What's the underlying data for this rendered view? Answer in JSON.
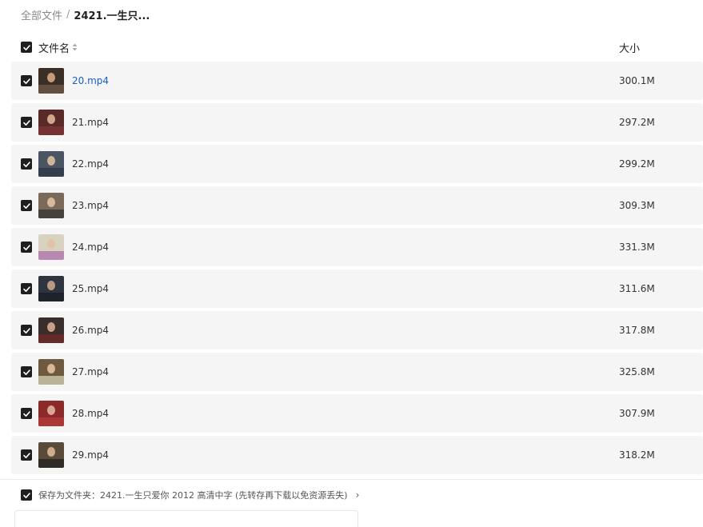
{
  "breadcrumb": {
    "root": "全部文件",
    "separator": "/",
    "current": "2421.一生只..."
  },
  "header": {
    "name_label": "文件名",
    "size_label": "大小"
  },
  "files": [
    {
      "name": "20.mp4",
      "size": "300.1M",
      "bg": "#3b2e25",
      "band": "#6b5544",
      "face": "#c49a7a",
      "active": true
    },
    {
      "name": "21.mp4",
      "size": "297.2M",
      "bg": "#5a2a2a",
      "band": "#7a3434",
      "face": "#d2a88a",
      "active": false
    },
    {
      "name": "22.mp4",
      "size": "299.2M",
      "bg": "#4a5463",
      "band": "#2f3a48",
      "face": "#cfb49a",
      "active": false
    },
    {
      "name": "23.mp4",
      "size": "309.3M",
      "bg": "#7a6a5a",
      "band": "#3c3a38",
      "face": "#d8b89a",
      "active": false
    },
    {
      "name": "24.mp4",
      "size": "331.3M",
      "bg": "#d9d2c0",
      "band": "#b07cae",
      "face": "#e2c2a8",
      "active": false
    },
    {
      "name": "25.mp4",
      "size": "311.6M",
      "bg": "#2e3440",
      "band": "#1c2028",
      "face": "#b89a84",
      "active": false
    },
    {
      "name": "26.mp4",
      "size": "317.8M",
      "bg": "#3a2e2a",
      "band": "#6a2a2a",
      "face": "#c8a088",
      "active": false
    },
    {
      "name": "27.mp4",
      "size": "325.8M",
      "bg": "#6e5a40",
      "band": "#c9c2a8",
      "face": "#d9b896",
      "active": false
    },
    {
      "name": "28.mp4",
      "size": "307.9M",
      "bg": "#8a2a2a",
      "band": "#b03a3a",
      "face": "#d8a890",
      "active": false
    },
    {
      "name": "29.mp4",
      "size": "318.2M",
      "bg": "#5a4a3a",
      "band": "#2a2622",
      "face": "#d0aa8c",
      "active": false
    }
  ],
  "footer": {
    "save_text": "保存为文件夹：2421.一生只爱你 2012 高清中字 (先转存再下载以免资源丢失)",
    "chevron": "›"
  }
}
